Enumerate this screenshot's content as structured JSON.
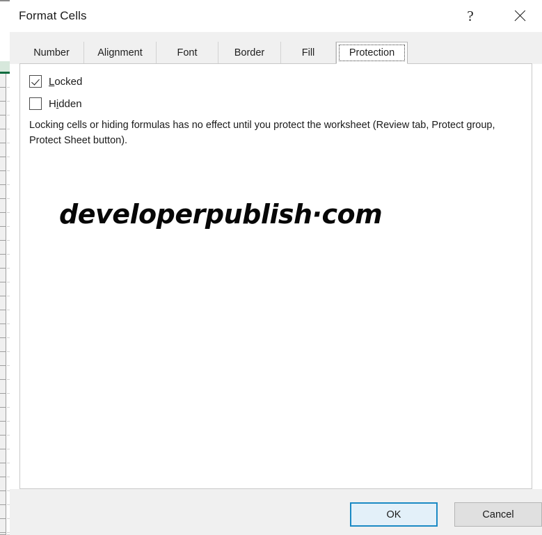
{
  "window": {
    "title": "Format Cells",
    "help_icon": "question-mark-icon",
    "close_icon": "close-x-icon"
  },
  "tabs": [
    {
      "label": "Number",
      "selected": false
    },
    {
      "label": "Alignment",
      "selected": false
    },
    {
      "label": "Font",
      "selected": false
    },
    {
      "label": "Border",
      "selected": false
    },
    {
      "label": "Fill",
      "selected": false
    },
    {
      "label": "Protection",
      "selected": true
    }
  ],
  "protection_panel": {
    "checkboxes": [
      {
        "name": "locked",
        "label_before": "",
        "label_accel": "L",
        "label_after": "ocked",
        "checked": true
      },
      {
        "name": "hidden",
        "label_before": "H",
        "label_accel": "i",
        "label_after": "dden",
        "checked": false
      }
    ],
    "description": "Locking cells or hiding formulas has no effect until you protect the worksheet (Review tab, Protect group, Protect Sheet button).",
    "watermark": "developerpublish·com"
  },
  "footer": {
    "ok_label": "OK",
    "cancel_label": "Cancel"
  },
  "colors": {
    "accent_blue": "#1a89c4",
    "ok_fill": "#e3f0f9",
    "dialog_chrome": "#f0f0f0",
    "panel_border": "#c8c8c8",
    "excel_selection_green": "#0d6b3f"
  }
}
